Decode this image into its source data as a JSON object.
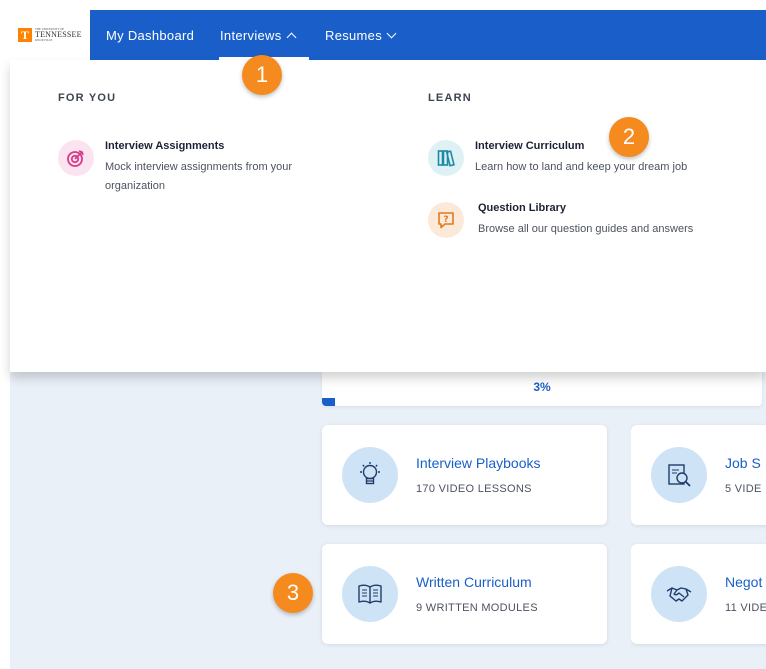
{
  "brand": {
    "logo_letter": "T",
    "logo_small": "THE UNIVERSITY OF",
    "logo_main": "TENNESSEE",
    "logo_sub": "KNOXVILLE"
  },
  "nav": {
    "dashboard": "My Dashboard",
    "interviews": "Interviews",
    "resumes": "Resumes"
  },
  "dropdown": {
    "for_you_title": "FOR YOU",
    "learn_title": "LEARN",
    "for_you_items": [
      {
        "title": "Interview Assignments",
        "desc_line1": "Mock interview assignments from your",
        "desc_line2": "organization",
        "icon": "target-icon"
      }
    ],
    "learn_items": [
      {
        "title": "Interview Curriculum",
        "desc": "Learn how to land and keep your dream job",
        "icon": "books-icon"
      },
      {
        "title": "Question Library",
        "desc": "Browse all our question guides and answers",
        "icon": "question-bubble-icon"
      }
    ]
  },
  "progress": {
    "label": "3%",
    "value_percent": 3
  },
  "cards": [
    {
      "title": "Interview Playbooks",
      "subtitle": "170 VIDEO LESSONS",
      "icon": "lightbulb-icon"
    },
    {
      "title": "Job S",
      "subtitle": "5 VIDE",
      "icon": "magnifier-document-icon"
    },
    {
      "title": "Written Curriculum",
      "subtitle": "9 WRITTEN MODULES",
      "icon": "open-book-icon"
    },
    {
      "title": "Negot",
      "subtitle": "11 VIDE",
      "icon": "handshake-icon"
    }
  ],
  "badges": [
    "1",
    "2",
    "3"
  ],
  "colors": {
    "primary": "#1a5fc9",
    "badge": "#f58a1f",
    "content_bg": "#eaf0f8",
    "icon_circle": "#cfe3f6"
  }
}
